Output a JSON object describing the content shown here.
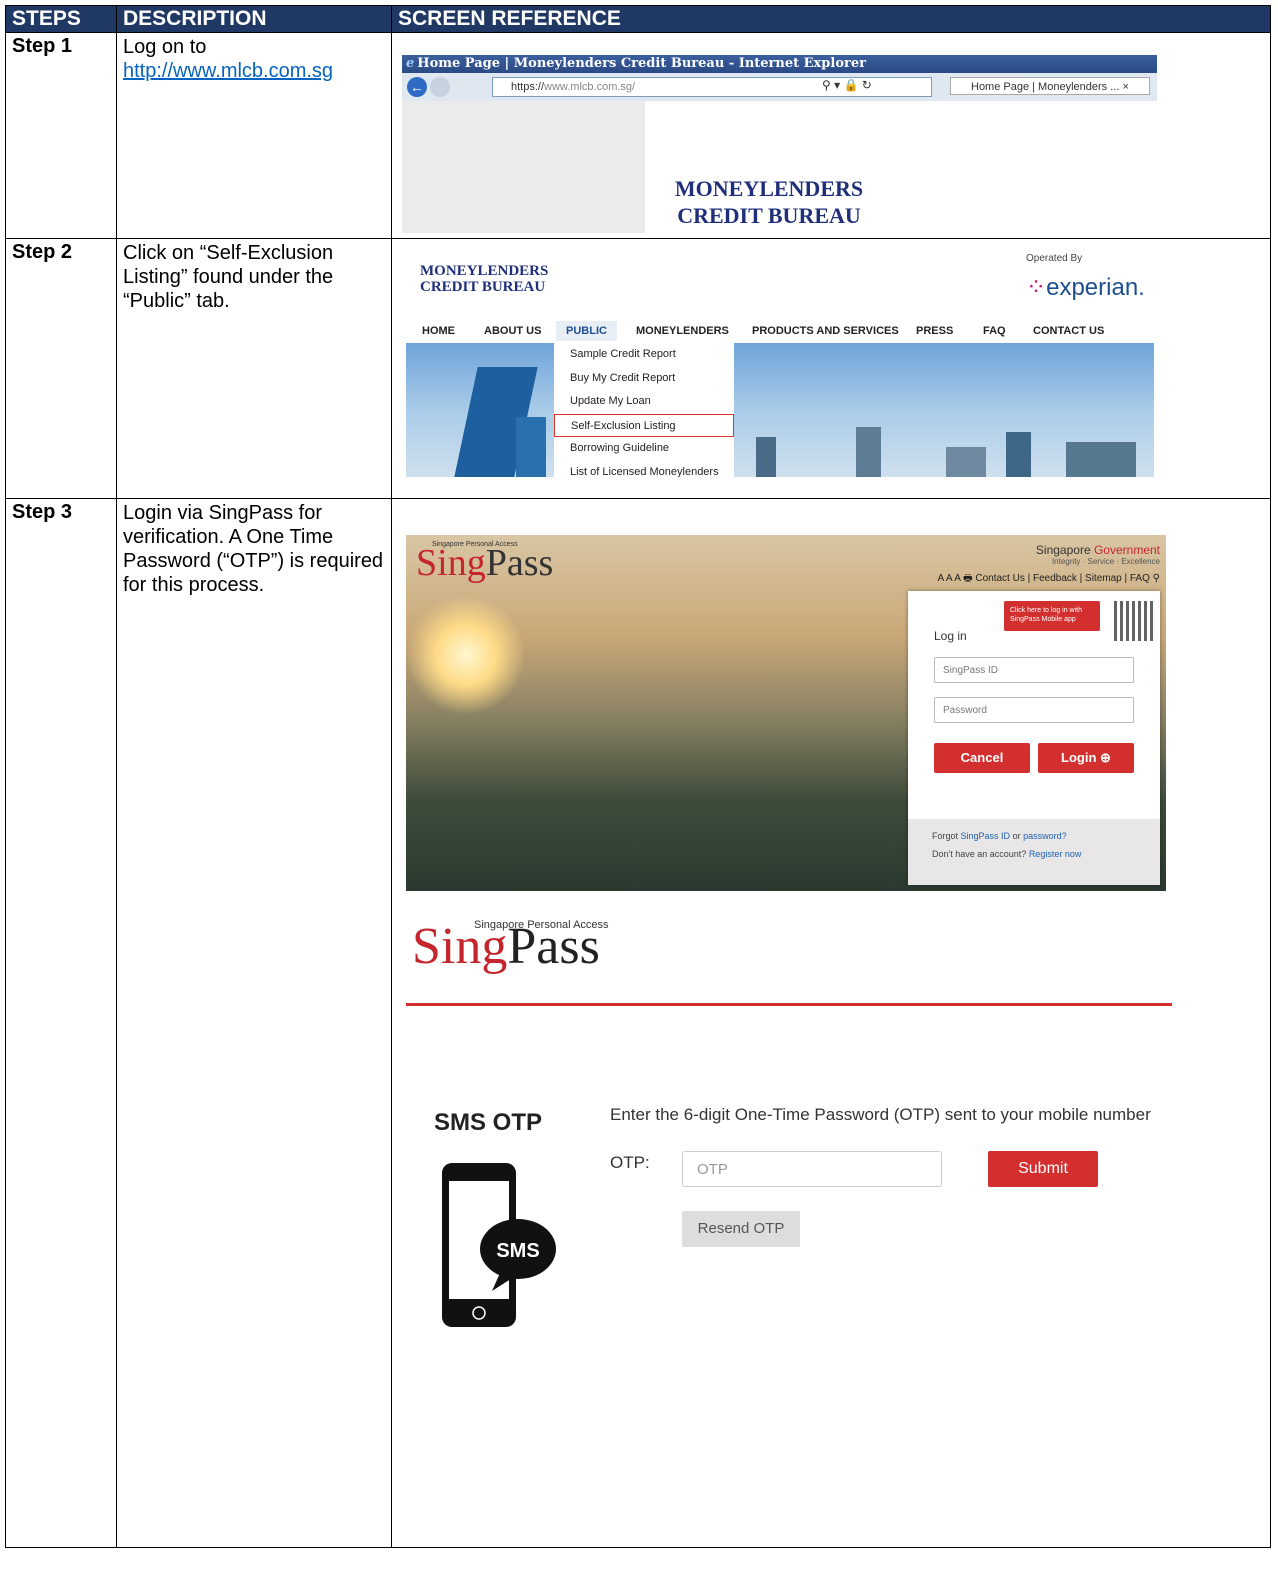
{
  "headers": {
    "steps": "STEPS",
    "description": "DESCRIPTION",
    "screen_reference": "SCREEN REFERENCE"
  },
  "step1": {
    "label": "Step 1",
    "desc_prefix": "Log on to",
    "url_link": "http://www.mlcb.com.sg",
    "ie_title": "Home Page | Moneylenders Credit Bureau - Internet Explorer",
    "address_https": "https://",
    "address_rest": "www.mlcb.com.sg/",
    "tab_label": "Home Page | Moneylenders ...",
    "tab_close": "×",
    "site_title_line1": "MONEYLENDERS",
    "site_title_line2": "CREDIT BUREAU"
  },
  "step2": {
    "label": "Step 2",
    "desc": "Click on “Self-Exclusion Listing” found under the “Public” tab.",
    "logo_line1": "MONEYLENDERS",
    "logo_line2": "CREDIT BUREAU",
    "operated_by": "Operated By",
    "experian": "experian.",
    "nav": [
      "HOME",
      "ABOUT US",
      "PUBLIC",
      "MONEYLENDERS",
      "PRODUCTS AND SERVICES",
      "PRESS",
      "FAQ",
      "CONTACT US"
    ],
    "dropdown": [
      "Sample Credit Report",
      "Buy My Credit Report",
      "Update My Loan",
      "Self-Exclusion Listing",
      "Borrowing Guideline",
      "List of Licensed Moneylenders"
    ]
  },
  "step3": {
    "label": "Step 3",
    "desc": "Login via SingPass for verification. A One Time Password (“OTP”) is required for this process.",
    "sp_small": "Singapore Personal Access",
    "sp_sing": "Sing",
    "sp_pass": "Pass",
    "gov_prefix": "Singapore",
    "gov_red": "Government",
    "gov_sub": "Integrity · Service · Excellence",
    "links": "A A A 🖶 Contact Us | Feedback | Sitemap | FAQ",
    "tooltip": "Click here to log in with SingPass Mobile app",
    "login_heading": "Log in",
    "singpass_id_placeholder": "SingPass ID",
    "password_placeholder": "Password",
    "cancel": "Cancel",
    "login": "Login ⊕",
    "forgot_prefix": "Forgot",
    "forgot_id": "SingPass ID",
    "forgot_or": "or",
    "forgot_pw": "password?",
    "no_account": "Don't have an account?",
    "register": "Register now",
    "otp_logo_small": "Singapore Personal Access",
    "otp_title": "SMS OTP",
    "otp_desc": "Enter the 6-digit One-Time Password (OTP) sent to your mobile number",
    "otp_label": "OTP:",
    "otp_placeholder": "OTP",
    "submit": "Submit",
    "resend": "Resend OTP",
    "sms_bubble": "SMS"
  }
}
